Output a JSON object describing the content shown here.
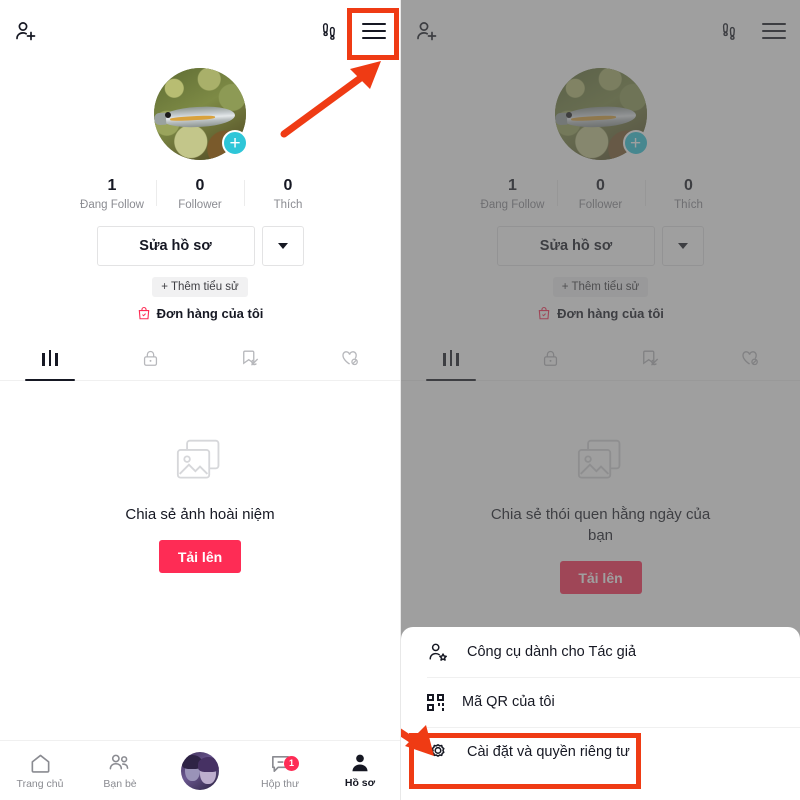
{
  "app": {
    "accent_red": "#fe2c55",
    "annotation_color": "#ef3b14",
    "badge_teal": "#2ec6d8",
    "dim_color": "rgba(90,90,90,0.58)"
  },
  "header": {
    "add_friend_icon": "person-add-icon",
    "footprints_icon": "footprints-icon",
    "menu_icon": "hamburger-menu-icon"
  },
  "profile": {
    "avatar_alt": "fish-avatar",
    "add_badge": "+",
    "stats": [
      {
        "value": "1",
        "label": "Đang Follow"
      },
      {
        "value": "0",
        "label": "Follower"
      },
      {
        "value": "0",
        "label": "Thích"
      }
    ],
    "edit_profile_label": "Sửa hồ sơ",
    "dropdown_icon": "chevron-down-icon",
    "add_bio_label": "+ Thêm tiểu sử",
    "orders_label": "Đơn hàng của tôi",
    "orders_icon": "shopping-bag-icon"
  },
  "tabs": [
    {
      "name": "posts",
      "icon": "grid-posts-icon",
      "active": true
    },
    {
      "name": "private",
      "icon": "lock-icon",
      "active": false
    },
    {
      "name": "saved",
      "icon": "bookmark-hidden-icon",
      "active": false
    },
    {
      "name": "liked",
      "icon": "heart-hidden-icon",
      "active": false
    }
  ],
  "empty_left": {
    "icon": "photos-stack-icon",
    "title": "Chia sẻ ảnh hoài niệm",
    "button_label": "Tải lên"
  },
  "empty_right": {
    "icon": "photos-stack-icon",
    "title": "Chia sẻ thói quen hằng ngày của bạn",
    "button_label": "Tải lên"
  },
  "bottom_nav": [
    {
      "name": "home",
      "label": "Trang chủ",
      "icon": "home-icon",
      "active": false
    },
    {
      "name": "friends",
      "label": "Bạn bè",
      "icon": "friends-icon",
      "active": false
    },
    {
      "name": "create",
      "label": "",
      "icon": "profile-avatar-icon",
      "active": false
    },
    {
      "name": "inbox",
      "label": "Hộp thư",
      "icon": "inbox-icon",
      "active": false,
      "badge": "1"
    },
    {
      "name": "profile",
      "label": "Hồ sơ",
      "icon": "person-icon",
      "active": true
    }
  ],
  "sheet_menu": [
    {
      "name": "creator-tools",
      "label": "Công cụ dành cho Tác giả",
      "icon": "person-star-icon",
      "highlighted": false
    },
    {
      "name": "my-qr-code",
      "label": "Mã QR của tôi",
      "icon": "qr-code-icon",
      "highlighted": false
    },
    {
      "name": "settings-privacy",
      "label": "Cài đặt và quyền riêng tư",
      "icon": "gear-icon",
      "highlighted": true
    }
  ],
  "annotations": {
    "box_menu_name": "highlight-box-hamburger",
    "box_settings_name": "highlight-box-settings",
    "arrow_left_name": "annotation-arrow-to-menu",
    "arrow_right_name": "annotation-arrow-to-settings"
  }
}
